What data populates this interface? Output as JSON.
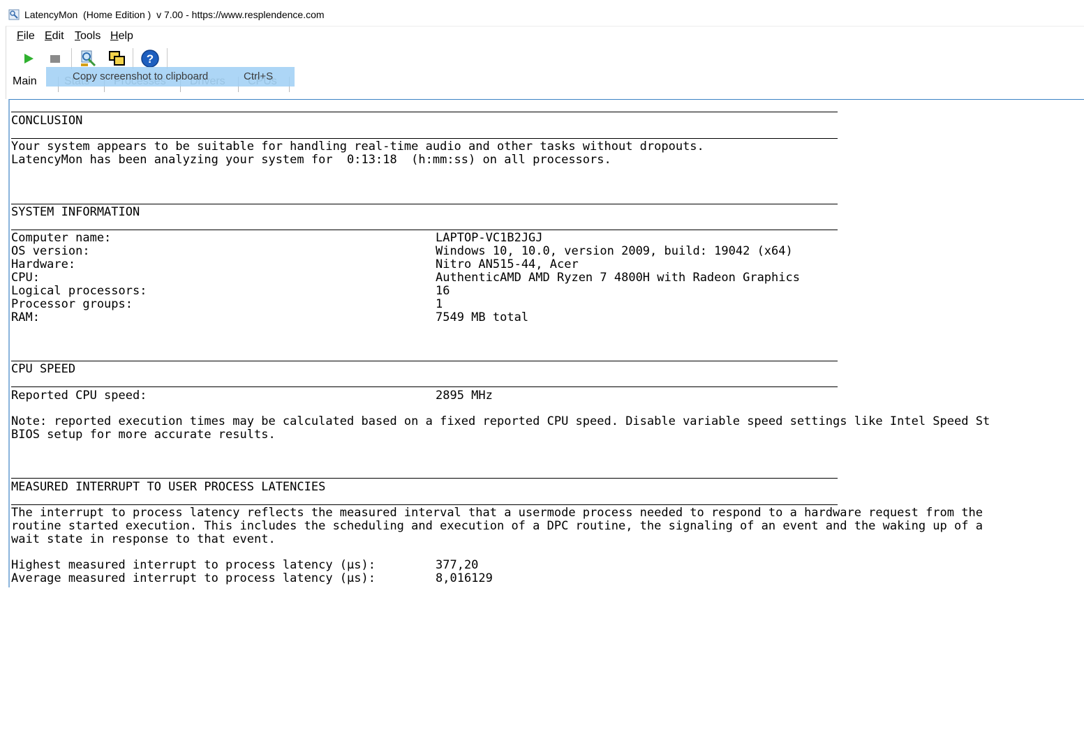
{
  "window": {
    "title": "LatencyMon  (Home Edition )  v 7.00 - https://www.resplendence.com"
  },
  "menu": {
    "items": [
      {
        "label": "File",
        "accel": "F",
        "rest": "ile"
      },
      {
        "label": "Edit",
        "accel": "E",
        "rest": "dit"
      },
      {
        "label": "Tools",
        "accel": "T",
        "rest": "ools"
      },
      {
        "label": "Help",
        "accel": "H",
        "rest": "elp"
      }
    ]
  },
  "toolbar": {
    "buttons": [
      {
        "name": "start-monitor",
        "icon": "play-icon",
        "color": "#2fb12f"
      },
      {
        "name": "stop-monitor",
        "icon": "stop-icon",
        "color": "#8a8a8a"
      },
      {
        "name": "analyze",
        "icon": "magnifier-wrench-icon"
      },
      {
        "name": "copy-screenshot",
        "icon": "copy-windows-icon"
      },
      {
        "name": "help",
        "icon": "help-icon",
        "color": "#1e5fbf"
      }
    ]
  },
  "tabs": {
    "main": "Main",
    "stats": "Stats",
    "processes": "Processes",
    "drivers": "Drivers",
    "cpus": "CPUs"
  },
  "tooltip": {
    "label": "Copy screenshot to clipboard",
    "shortcut": "Ctrl+S"
  },
  "report": {
    "conclusion": {
      "heading": "CONCLUSION",
      "line1": "Your system appears to be suitable for handling real-time audio and other tasks without dropouts.",
      "line2": "LatencyMon has been analyzing your system for  0:13:18  (h:mm:ss) on all processors."
    },
    "system_info": {
      "heading": "SYSTEM INFORMATION",
      "rows": [
        {
          "label": "Computer name:",
          "value": "LAPTOP-VC1B2JGJ"
        },
        {
          "label": "OS version:",
          "value": "Windows 10, 10.0, version 2009, build: 19042 (x64)"
        },
        {
          "label": "Hardware:",
          "value": "Nitro AN515-44, Acer"
        },
        {
          "label": "CPU:",
          "value": "AuthenticAMD AMD Ryzen 7 4800H with Radeon Graphics"
        },
        {
          "label": "Logical processors:",
          "value": "16"
        },
        {
          "label": "Processor groups:",
          "value": "1"
        },
        {
          "label": "RAM:",
          "value": "7549 MB total"
        }
      ]
    },
    "cpu_speed": {
      "heading": "CPU SPEED",
      "label": "Reported CPU speed:",
      "value": "2895 MHz",
      "note1": "Note: reported execution times may be calculated based on a fixed reported CPU speed. Disable variable speed settings like Intel Speed St",
      "note2": "BIOS setup for more accurate results."
    },
    "interrupt": {
      "heading": "MEASURED INTERRUPT TO USER PROCESS LATENCIES",
      "para1": "The interrupt to process latency reflects the measured interval that a usermode process needed to respond to a hardware request from the",
      "para2": "routine started execution. This includes the scheduling and execution of a DPC routine, the signaling of an event and the waking up of a",
      "para3": "wait state in response to that event.",
      "highest_label": "Highest measured interrupt to process latency (µs):",
      "highest_value": "377,20",
      "average_label": "Average measured interrupt to process latency (µs):",
      "average_value": "8,016129"
    }
  }
}
